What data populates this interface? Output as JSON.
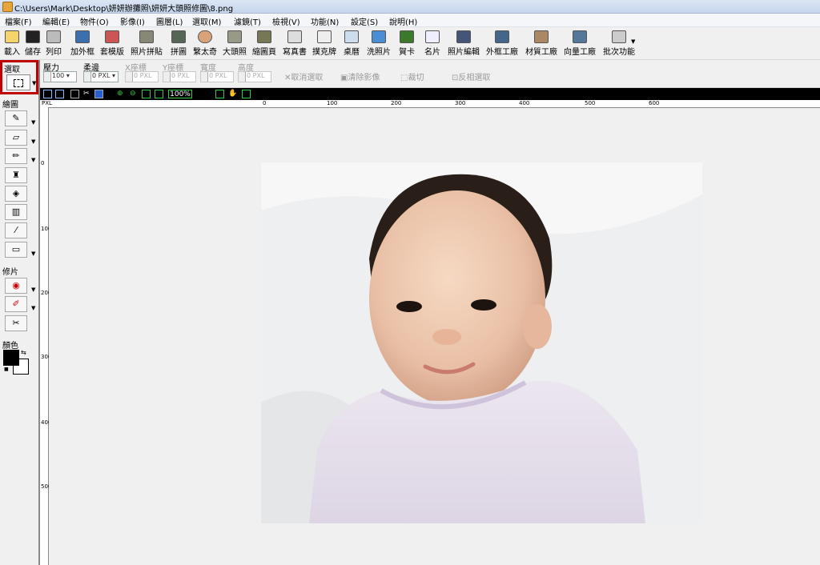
{
  "window": {
    "title": "C:\\Users\\Mark\\Desktop\\妍妍辦攤照\\妍妍大頭照修圖\\8.png"
  },
  "menu": [
    "檔案(F)",
    "編輯(E)",
    "物件(O)",
    "影像(I)",
    "圖層(L)",
    "選取(M)",
    "濾鏡(T)",
    "檢視(V)",
    "功能(N)",
    "設定(S)",
    "說明(H)"
  ],
  "toolbar": [
    {
      "label": "載入",
      "icon": "folder-open-icon"
    },
    {
      "label": "儲存",
      "icon": "save-disk-icon"
    },
    {
      "label": "列印",
      "icon": "printer-icon"
    },
    {
      "label": "加外框",
      "icon": "frame-icon"
    },
    {
      "label": "套模版",
      "icon": "template-icon"
    },
    {
      "label": "照片拼貼",
      "icon": "photo-collage-icon"
    },
    {
      "label": "拼圖",
      "icon": "puzzle-grid-icon"
    },
    {
      "label": "繫太奇",
      "icon": "montage-person-icon"
    },
    {
      "label": "大頭照",
      "icon": "id-photo-icon"
    },
    {
      "label": "縮圖頁",
      "icon": "thumbnail-page-icon"
    },
    {
      "label": "寫真書",
      "icon": "photo-book-icon"
    },
    {
      "label": "撲克牌",
      "icon": "playing-cards-icon"
    },
    {
      "label": "桌曆",
      "icon": "desk-calendar-icon"
    },
    {
      "label": "洗照片",
      "icon": "print-photo-icon"
    },
    {
      "label": "賀卡",
      "icon": "greeting-card-icon"
    },
    {
      "label": "名片",
      "icon": "business-card-icon"
    },
    {
      "label": "照片編輯",
      "icon": "photo-edit-icon"
    },
    {
      "label": "外框工廠",
      "icon": "frame-factory-icon"
    },
    {
      "label": "材質工廠",
      "icon": "texture-factory-icon"
    },
    {
      "label": "向量工廠",
      "icon": "vector-factory-icon"
    },
    {
      "label": "批次功能",
      "icon": "batch-icon"
    }
  ],
  "options": {
    "pressure_label": "壓力",
    "pressure_value": "100",
    "feather_label": "柔邊",
    "feather_value": "0",
    "x_label": "X座標",
    "x_value": "0",
    "y_label": "Y座標",
    "y_value": "0",
    "width_label": "寬度",
    "width_value": "0",
    "height_label": "高度",
    "height_value": "0",
    "unit": "PXL",
    "cancel_select": "取消選取",
    "clear_image": "清除影像",
    "crop": "裁切",
    "invert_select": "反相選取"
  },
  "left_panel": {
    "select_label": "選取",
    "draw_label": "繪圖",
    "retouch_label": "修片",
    "color_label": "顏色",
    "foreground_color": "#000000",
    "background_color": "#ffffff",
    "selection_highlight_color": "#c00000"
  },
  "viewbar": {
    "zoom": "100%"
  },
  "ruler": {
    "unit": "PXL",
    "h_ticks": [
      "0",
      "100",
      "200",
      "300",
      "400",
      "500",
      "600"
    ],
    "v_ticks": [
      "0",
      "100",
      "200",
      "300",
      "400",
      "500"
    ]
  },
  "image": {
    "subject": "baby-photo"
  }
}
